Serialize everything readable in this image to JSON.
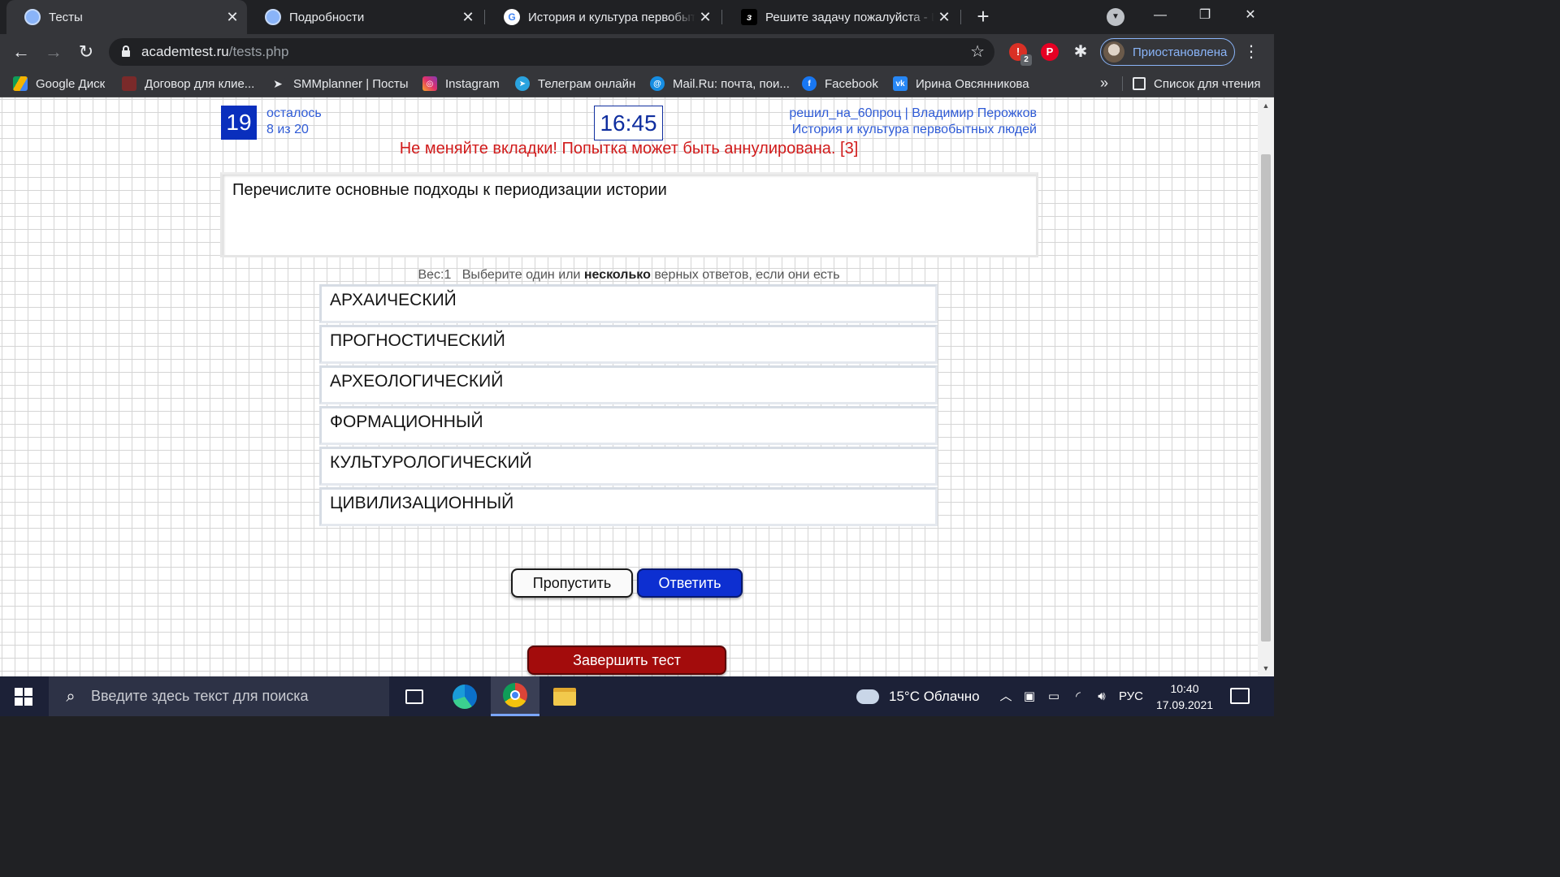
{
  "browser": {
    "tabs": [
      {
        "title": "Тесты",
        "icon": "globe-icon",
        "active": true
      },
      {
        "title": "Подробности",
        "icon": "globe-icon",
        "active": false
      },
      {
        "title": "История и культура первобытных",
        "icon": "google-icon",
        "active": false
      },
      {
        "title": "Решите задачу пожалуйста - Шк",
        "icon": "znanija-icon",
        "active": false
      }
    ],
    "url_domain": "academtest.ru",
    "url_path": "/tests.php",
    "extension_badge": "2",
    "profile_label": "Приостановлена",
    "bookmarks": [
      {
        "label": "Google Диск",
        "icon": "google-drive-icon"
      },
      {
        "label": "Договор для клие...",
        "icon": "document-icon"
      },
      {
        "label": "SMMplanner | Посты",
        "icon": "paper-plane-icon"
      },
      {
        "label": "Instagram",
        "icon": "instagram-icon"
      },
      {
        "label": "Телеграм онлайн",
        "icon": "telegram-icon"
      },
      {
        "label": "Mail.Ru: почта, пои...",
        "icon": "mailru-icon"
      },
      {
        "label": "Facebook",
        "icon": "facebook-icon"
      },
      {
        "label": "Ирина Овсянникова",
        "icon": "vk-icon"
      }
    ],
    "bookmarks_more": "»",
    "reading_list": "Список для чтения"
  },
  "test": {
    "question_number": "19",
    "remaining_label": "осталось",
    "remaining_count": "8 из 20",
    "timer": "16:45",
    "user_line": "решил_на_60проц | Владимир Перожков",
    "course": "История и культура первобытных людей",
    "warning": "Не меняйте вкладки! Попытка может быть аннулирована. [3]",
    "question": "Перечислите основные подходы к периодизации истории",
    "weight": "Вес:1",
    "hint_pre": "Выберите один или",
    "hint_bold": "несколько",
    "hint_post": "верных ответов, если они есть",
    "answers": [
      "АРХАИЧЕСКИЙ",
      "ПРОГНОСТИЧЕСКИЙ",
      "АРХЕОЛОГИЧЕСКИЙ",
      "ФОРМАЦИОННЫЙ",
      "КУЛЬТУРОЛОГИЧЕСКИЙ",
      "ЦИВИЛИЗАЦИОННЫЙ"
    ],
    "skip_label": "Пропустить",
    "answer_label": "Ответить",
    "finish_label": "Завершить тест"
  },
  "taskbar": {
    "search_placeholder": "Введите здесь текст для поиска",
    "weather": "15°C Облачно",
    "language": "РУС",
    "time": "10:40",
    "date": "17.09.2021"
  },
  "colors": {
    "accent_blue": "#0d2fd1",
    "finish_red": "#a30c0c",
    "warning_red": "#d11b1b",
    "link_blue": "#2f5bd6"
  }
}
